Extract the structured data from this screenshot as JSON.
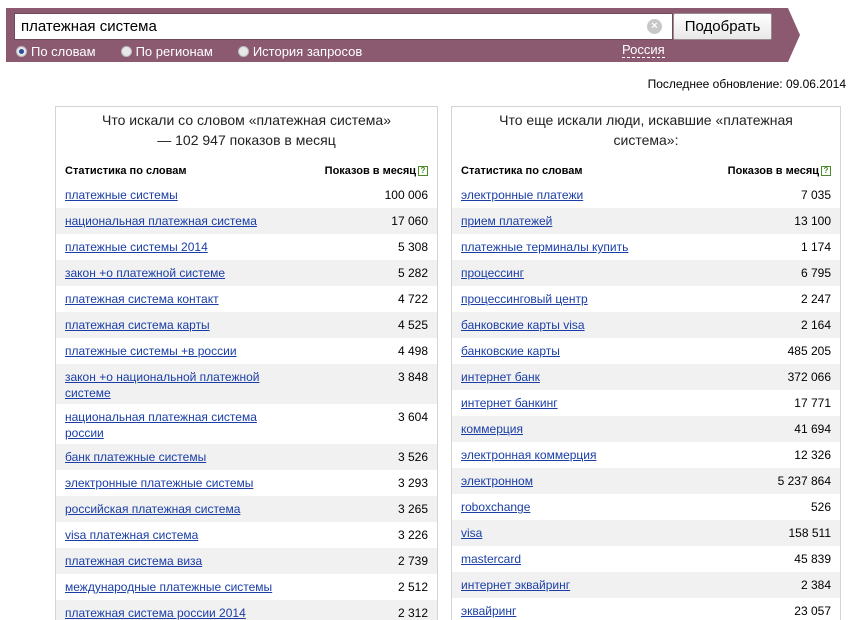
{
  "search": {
    "query": "платежная система",
    "clear_symbol": "×",
    "button_label": "Подобрать",
    "modes": [
      {
        "label": "По словам",
        "selected": true
      },
      {
        "label": "По регионам",
        "selected": false
      },
      {
        "label": "История запросов",
        "selected": false
      }
    ],
    "region": "Россия"
  },
  "last_update": "Последнее обновление: 09.06.2014",
  "left_panel": {
    "title": "Что искали со словом «платежная система» — 102 947 показов в месяц",
    "col_keyword": "Статистика по словам",
    "col_count": "Показов в месяц",
    "help_icon": "?",
    "rows": [
      {
        "keyword": "платежные системы",
        "count": "100 006"
      },
      {
        "keyword": "национальная платежная система",
        "count": "17 060"
      },
      {
        "keyword": "платежные системы 2014",
        "count": "5 308"
      },
      {
        "keyword": "закон +о платежной системе",
        "count": "5 282"
      },
      {
        "keyword": "платежная система контакт",
        "count": "4 722"
      },
      {
        "keyword": "платежная система карты",
        "count": "4 525"
      },
      {
        "keyword": "платежные системы +в россии",
        "count": "4 498"
      },
      {
        "keyword": "закон +о национальной платежной системе",
        "count": "3 848"
      },
      {
        "keyword": "национальная платежная система россии",
        "count": "3 604"
      },
      {
        "keyword": "банк платежные системы",
        "count": "3 526"
      },
      {
        "keyword": "электронные платежные системы",
        "count": "3 293"
      },
      {
        "keyword": "российская платежная система",
        "count": "3 265"
      },
      {
        "keyword": "visa платежная система",
        "count": "3 226"
      },
      {
        "keyword": "платежная система виза",
        "count": "2 739"
      },
      {
        "keyword": "международные платежные системы",
        "count": "2 512"
      },
      {
        "keyword": "платежная система россии 2014",
        "count": "2 312"
      }
    ]
  },
  "right_panel": {
    "title": "Что еще искали люди, искавшие «платежная система»:",
    "col_keyword": "Статистика по словам",
    "col_count": "Показов в месяц",
    "help_icon": "?",
    "rows": [
      {
        "keyword": "электронные платежи",
        "count": "7 035"
      },
      {
        "keyword": "прием платежей",
        "count": "13 100"
      },
      {
        "keyword": "платежные терминалы купить",
        "count": "1 174"
      },
      {
        "keyword": "процессинг",
        "count": "6 795"
      },
      {
        "keyword": "процессинговый центр",
        "count": "2 247"
      },
      {
        "keyword": "банковские карты visa",
        "count": "2 164"
      },
      {
        "keyword": "банковские карты",
        "count": "485 205"
      },
      {
        "keyword": "интернет банк",
        "count": "372 066"
      },
      {
        "keyword": "интернет банкинг",
        "count": "17 771"
      },
      {
        "keyword": "коммерция",
        "count": "41 694"
      },
      {
        "keyword": "электронная коммерция",
        "count": "12 326"
      },
      {
        "keyword": "электронном",
        "count": "5 237 864"
      },
      {
        "keyword": "roboxchange",
        "count": "526"
      },
      {
        "keyword": "visa",
        "count": "158 511"
      },
      {
        "keyword": "mastercard",
        "count": "45 839"
      },
      {
        "keyword": "интернет эквайринг",
        "count": "2 384"
      },
      {
        "keyword": "эквайринг",
        "count": "23 057"
      }
    ]
  },
  "colors": {
    "bar": "#8b5a70",
    "link": "#1a3ea6",
    "zebra": "#f1f1f1"
  }
}
